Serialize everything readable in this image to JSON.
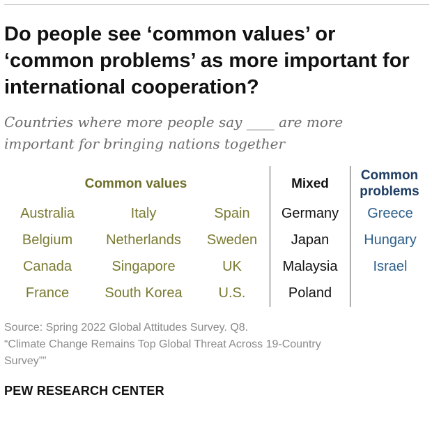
{
  "title": "Do people see ‘common values’ or ‘common problems’ as more important for international cooperation?",
  "subtitle_line1": "Countries where more people say ____ are more",
  "subtitle_line2": "important for bringing nations together",
  "chart_data": {
    "type": "table",
    "columns": [
      {
        "header": "Common values",
        "countries": [
          "Australia",
          "Belgium",
          "Canada",
          "France",
          "Italy",
          "Netherlands",
          "Singapore",
          "South Korea",
          "Spain",
          "Sweden",
          "UK",
          "U.S."
        ]
      },
      {
        "header": "Mixed",
        "countries": [
          "Germany",
          "Japan",
          "Malaysia",
          "Poland"
        ]
      },
      {
        "header": "Common problems",
        "countries": [
          "Greece",
          "Hungary",
          "Israel"
        ]
      }
    ],
    "colors": {
      "common_values": "#7a7a33",
      "mixed": "#111111",
      "common_problems": "#2c5f8a"
    }
  },
  "source_line1": "Source: Spring 2022 Global Attitudes Survey. Q8.",
  "source_line2": "“Climate Change Remains Top Global Threat Across 19-Country",
  "source_line3": "Survey””",
  "brand": "PEW RESEARCH CENTER"
}
